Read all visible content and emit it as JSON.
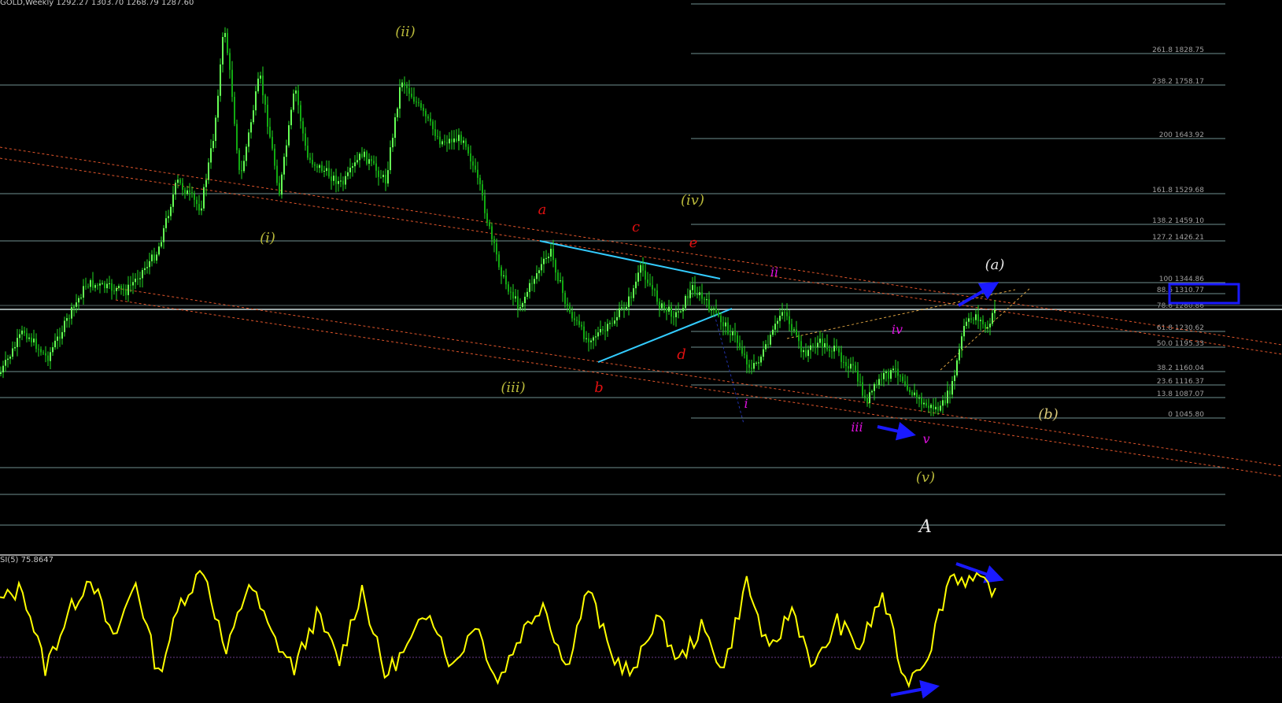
{
  "header": {
    "symbol_label": "GOLD,Weekly",
    "ohlc": "1292.27 1303.70 1268.79 1287.60"
  },
  "indicator": {
    "label": "SI(5) 75.8647"
  },
  "colors": {
    "background": "#000000",
    "candles": "#22dd22",
    "rsi_line": "#ffff00",
    "fib_lines": "#6f8f8f",
    "channel": "#e0552b",
    "triangle": "#33ccff",
    "arrow": "#1a1aff",
    "highlight_box": "#1a1aff"
  },
  "fib_levels": [
    {
      "label": "261.8 1828.75"
    },
    {
      "label": "238.2 1758.17"
    },
    {
      "label": "200 1643.92"
    },
    {
      "label": "161.8 1529.68"
    },
    {
      "label": "138.2 1459.10"
    },
    {
      "label": "127.2 1426.21"
    },
    {
      "label": "100 1344.86"
    },
    {
      "label": "88.6 1310.77"
    },
    {
      "label": "78.6 1280.86"
    },
    {
      "label": "61.8 1230.62"
    },
    {
      "label": "50.0 1195.33"
    },
    {
      "label": "38.2 1160.04"
    },
    {
      "label": "23.6 1116.37"
    },
    {
      "label": "13.8 1087.07"
    },
    {
      "label": "0 1045.80"
    }
  ],
  "wave_labels": {
    "olive": [
      "(i)",
      "(ii)",
      "(iii)",
      "(iv)",
      "(v)"
    ],
    "red": [
      "a",
      "b",
      "c",
      "d",
      "e"
    ],
    "magenta": [
      "i",
      "ii",
      "iii",
      "iv",
      "v"
    ],
    "white": [
      "(a)",
      "(b)",
      "A"
    ]
  },
  "chart_data": {
    "type": "line",
    "title": "GOLD,Weekly",
    "series": [
      {
        "name": "GOLD,Weekly",
        "open": 1292.27,
        "high": 1303.7,
        "low": 1268.79,
        "close": 1287.6,
        "approx_closes": [
          1200,
          1230,
          1270,
          1320,
          1400,
          1500,
          1620,
          1780,
          1560,
          1650,
          1700,
          1620,
          1580,
          1650,
          1720,
          1620,
          1500,
          1330,
          1280,
          1240,
          1350,
          1290,
          1230,
          1300,
          1260,
          1330,
          1290,
          1270,
          1250,
          1200,
          1180,
          1220,
          1160,
          1190,
          1150,
          1090,
          1140,
          1170,
          1120,
          1070,
          1060,
          1090,
          1240,
          1280,
          1290
        ]
      },
      {
        "name": "RSI(5)",
        "last_value": 75.8647,
        "approx_values": [
          70,
          80,
          20,
          60,
          90,
          40,
          85,
          15,
          70,
          95,
          30,
          85,
          45,
          20,
          60,
          25,
          80,
          15,
          35,
          65,
          20,
          55,
          10,
          45,
          70,
          20,
          80,
          30,
          15,
          60,
          25,
          50,
          20,
          85,
          30,
          65,
          20,
          55,
          35,
          75,
          10,
          30,
          90,
          85,
          80
        ]
      }
    ],
    "fib_price_range": [
      1045.8,
      1942
    ],
    "grid": false
  }
}
